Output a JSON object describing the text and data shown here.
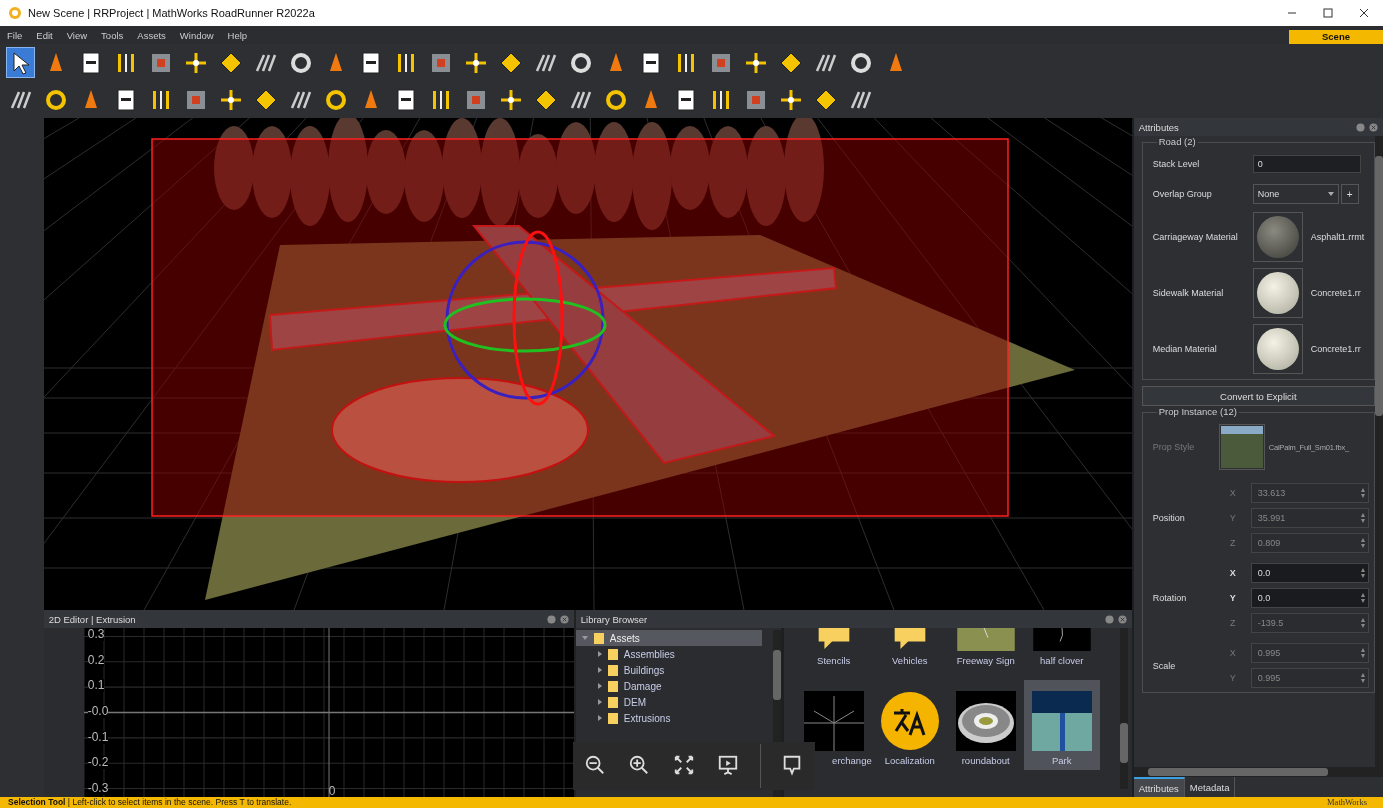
{
  "window": {
    "title": "New Scene | RRProject | MathWorks RoadRunner R2022a"
  },
  "menu": [
    "File",
    "Edit",
    "View",
    "Tools",
    "Assets",
    "Window",
    "Help"
  ],
  "scene_tab": "Scene",
  "toolbar_rows": [
    {
      "tools": [
        {
          "selected": true
        },
        {
          "selected": false
        },
        {
          "selected": false
        },
        {
          "selected": false
        },
        {
          "selected": false
        },
        {
          "selected": false
        },
        {
          "selected": false
        },
        {
          "selected": false
        },
        {
          "selected": false
        },
        {
          "selected": false
        },
        {
          "selected": false
        },
        {
          "selected": false
        },
        {
          "selected": false
        },
        {
          "selected": false
        },
        {
          "selected": false
        },
        {
          "selected": false
        },
        {
          "selected": false
        },
        {
          "selected": false
        },
        {
          "selected": false
        },
        {
          "selected": false
        },
        {
          "selected": false
        },
        {
          "selected": false
        },
        {
          "selected": false
        },
        {
          "selected": false
        },
        {
          "selected": false
        },
        {
          "selected": false
        }
      ]
    },
    {
      "tools": [
        {
          "selected": false
        },
        {
          "selected": false
        },
        {
          "selected": false
        },
        {
          "selected": false
        },
        {
          "selected": false
        },
        {
          "selected": false
        },
        {
          "selected": false
        },
        {
          "selected": false
        },
        {
          "selected": false
        },
        {
          "selected": false
        },
        {
          "selected": false
        },
        {
          "selected": false
        },
        {
          "selected": false
        },
        {
          "selected": false
        },
        {
          "selected": false
        },
        {
          "selected": false
        },
        {
          "selected": false
        },
        {
          "selected": false
        },
        {
          "selected": false
        },
        {
          "selected": false
        },
        {
          "selected": false
        },
        {
          "selected": false
        },
        {
          "selected": false
        },
        {
          "selected": false
        },
        {
          "selected": false
        }
      ]
    }
  ],
  "editor_2d": {
    "title": "2D Editor | Extrusion",
    "y_labels": [
      "0.3",
      "0.2",
      "0.1",
      "-0.0",
      "-0.1",
      "-0.2",
      "-0.3"
    ],
    "x_label": "0"
  },
  "library": {
    "title": "Library Browser",
    "tree": [
      {
        "label": "Assets",
        "expanded": true,
        "selected": true,
        "children": [
          {
            "label": "Assemblies",
            "expanded": false,
            "selected": false
          },
          {
            "label": "Buildings",
            "expanded": false,
            "selected": false
          },
          {
            "label": "Damage",
            "expanded": false,
            "selected": false
          },
          {
            "label": "DEM",
            "expanded": false,
            "selected": false
          },
          {
            "label": "Extrusions",
            "expanded": false,
            "selected": false
          }
        ]
      }
    ],
    "assets": [
      {
        "name": "Stencils",
        "kind": "folder",
        "selected": false
      },
      {
        "name": "Vehicles",
        "kind": "folder",
        "selected": false
      },
      {
        "name": "Freeway Sign",
        "kind": "sign",
        "selected": false
      },
      {
        "name": "half clover",
        "kind": "dark",
        "selected": false
      },
      {
        "name": "erchange",
        "kind": "interchange",
        "selected": false
      },
      {
        "name": "Localization",
        "kind": "localization",
        "selected": false
      },
      {
        "name": "roundabout",
        "kind": "roundabout",
        "selected": false
      },
      {
        "name": "Park",
        "kind": "park",
        "selected": true
      }
    ]
  },
  "attributes": {
    "title": "Attributes",
    "road": {
      "title": "Road (2)",
      "stack_level": {
        "label": "Stack Level",
        "value": "0"
      },
      "overlap_group": {
        "label": "Overlap Group",
        "value": "None",
        "add": "+"
      },
      "materials": [
        {
          "label": "Carriageway Material",
          "file": "Asphalt1.rrmt",
          "kind": "asphalt"
        },
        {
          "label": "Sidewalk Material",
          "file": "Concrete1.rr",
          "kind": "concrete"
        },
        {
          "label": "Median Material",
          "file": "Concrete1.rr",
          "kind": "concrete"
        }
      ]
    },
    "convert_button": "Convert to Explicit",
    "prop": {
      "title": "Prop Instance (12)",
      "style": {
        "label": "Prop Style",
        "disabled": true,
        "file": "CalPalm_Full_Sm01.fbx_"
      },
      "groups": [
        {
          "label": "Position",
          "axes": [
            {
              "axis": "X",
              "value": "33.613",
              "disabled": true
            },
            {
              "axis": "Y",
              "value": "35.991",
              "disabled": true
            },
            {
              "axis": "Z",
              "value": "0.809",
              "disabled": true
            }
          ]
        },
        {
          "label": "Rotation",
          "axes": [
            {
              "axis": "X",
              "value": "0.0",
              "disabled": false
            },
            {
              "axis": "Y",
              "value": "0.0",
              "disabled": false
            },
            {
              "axis": "Z",
              "value": "-139.5",
              "disabled": true
            }
          ]
        },
        {
          "label": "Scale",
          "axes": [
            {
              "axis": "X",
              "value": "0.995",
              "disabled": true
            },
            {
              "axis": "Y",
              "value": "0.995",
              "disabled": true
            }
          ]
        }
      ]
    },
    "tabs": [
      {
        "label": "Attributes",
        "selected": true
      },
      {
        "label": "Metadata",
        "selected": false
      }
    ]
  },
  "status_bar": {
    "tool": "Selection Tool",
    "message": "| Left-click to select items in the scene. Press T to translate.",
    "brand": "MathWorks"
  }
}
